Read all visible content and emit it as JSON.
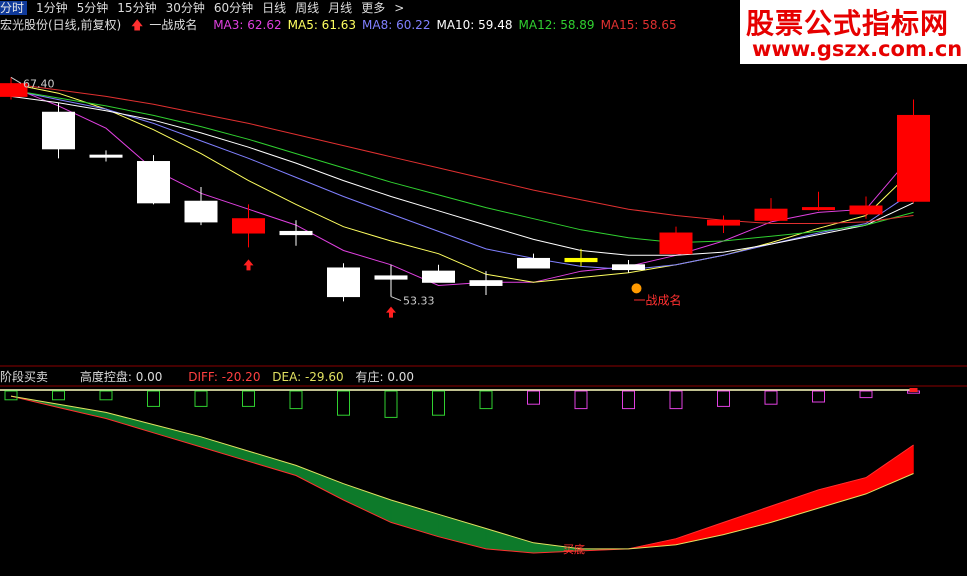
{
  "toolbar": {
    "items": [
      "分时",
      "1分钟",
      "5分钟",
      "15分钟",
      "30分钟",
      "60分钟",
      "日线",
      "周线",
      "月线",
      "更多",
      ">"
    ]
  },
  "stock_title": "宏光股份(日线,前复权)",
  "signal_label": "一战成名",
  "ma_legend": [
    {
      "label": "MA3: ",
      "value": "62.62",
      "color": "#e040e0"
    },
    {
      "label": "MA5: ",
      "value": "61.63",
      "color": "#ffff60"
    },
    {
      "label": "MA8: ",
      "value": "60.22",
      "color": "#8080ff"
    },
    {
      "label": "MA10: ",
      "value": "59.48",
      "color": "#ffffff"
    },
    {
      "label": "MA12: ",
      "value": "58.89",
      "color": "#30d030"
    },
    {
      "label": "MA15: ",
      "value": "58.65",
      "color": "#e03030"
    }
  ],
  "macd_legend": {
    "section": "阶段买卖",
    "gaodu_label": "高度控盘: ",
    "gaodu_value": "0.00",
    "diff_label": "DIFF: ",
    "diff_value": "-20.20",
    "dea_label": "DEA: ",
    "dea_value": "-29.60",
    "youzhuang_label": "有庄: ",
    "youzhuang_value": "0.00"
  },
  "watermark": {
    "title": "股票公式指标网",
    "url": "www.gszx.com.cn"
  },
  "colors": {
    "up": "#ff0000",
    "down": "#ffffff",
    "signal_box": "#ffff00",
    "green_band": "#0d7a2a",
    "red_band": "#ff0000"
  },
  "chart_data": [
    {
      "type": "candlestick",
      "annotations": [
        {
          "text": "67.40",
          "kind": "high"
        },
        {
          "text": "53.33",
          "kind": "low"
        },
        {
          "text": "一战成名",
          "kind": "signal"
        }
      ],
      "ylim": [
        52,
        70
      ],
      "candles": [
        {
          "o": 66.2,
          "c": 67.0,
          "h": 67.4,
          "l": 66.0
        },
        {
          "o": 65.2,
          "c": 62.9,
          "h": 65.8,
          "l": 62.3
        },
        {
          "o": 62.5,
          "c": 62.4,
          "h": 62.8,
          "l": 62.1
        },
        {
          "o": 62.1,
          "c": 59.5,
          "h": 62.5,
          "l": 59.4
        },
        {
          "o": 59.6,
          "c": 58.3,
          "h": 60.5,
          "l": 58.1
        },
        {
          "o": 57.6,
          "c": 58.5,
          "h": 59.4,
          "l": 56.7
        },
        {
          "o": 57.7,
          "c": 57.5,
          "h": 58.4,
          "l": 56.8
        },
        {
          "o": 55.4,
          "c": 53.6,
          "h": 55.7,
          "l": 53.3
        },
        {
          "o": 54.9,
          "c": 54.7,
          "h": 55.6,
          "l": 53.6
        },
        {
          "o": 55.2,
          "c": 54.5,
          "h": 55.6,
          "l": 54.5
        },
        {
          "o": 54.6,
          "c": 54.3,
          "h": 55.2,
          "l": 53.7
        },
        {
          "o": 56.0,
          "c": 55.4,
          "h": 56.3,
          "l": 55.4
        },
        {
          "o": 56.0,
          "c": 55.8,
          "h": 56.6,
          "l": 55.5
        },
        {
          "o": 55.6,
          "c": 55.3,
          "h": 55.9,
          "l": 55.1
        },
        {
          "o": 56.3,
          "c": 57.6,
          "h": 58.0,
          "l": 56.3
        },
        {
          "o": 58.1,
          "c": 58.4,
          "h": 58.7,
          "l": 57.6
        },
        {
          "o": 58.4,
          "c": 59.1,
          "h": 59.8,
          "l": 58.3
        },
        {
          "o": 59.2,
          "c": 59.2,
          "h": 60.2,
          "l": 59.0
        },
        {
          "o": 58.8,
          "c": 59.3,
          "h": 59.9,
          "l": 58.5
        },
        {
          "o": 59.6,
          "c": 65.0,
          "h": 66.0,
          "l": 59.5
        }
      ],
      "series": [
        {
          "name": "MA3",
          "color": "#e040e0",
          "values": [
            66.8,
            65.6,
            64.2,
            61.6,
            60.1,
            59.1,
            58.1,
            56.5,
            55.6,
            54.3,
            54.5,
            54.5,
            55.2,
            55.5,
            56.2,
            57.1,
            58.3,
            58.9,
            59.1,
            62.6
          ]
        },
        {
          "name": "MA5",
          "color": "#ffff60",
          "values": [
            67.0,
            66.4,
            65.4,
            64.1,
            62.6,
            60.9,
            59.4,
            58.0,
            57.1,
            56.3,
            55.0,
            54.5,
            54.8,
            55.1,
            55.6,
            56.2,
            57.0,
            57.9,
            58.7,
            61.6
          ]
        },
        {
          "name": "MA8",
          "color": "#8080ff",
          "values": [
            66.6,
            66.0,
            65.4,
            64.5,
            63.4,
            62.3,
            61.1,
            59.9,
            58.8,
            57.7,
            56.6,
            56.0,
            55.5,
            55.3,
            55.6,
            56.2,
            56.9,
            57.6,
            58.2,
            60.2
          ]
        },
        {
          "name": "MA10",
          "color": "#ffffff",
          "values": [
            66.2,
            65.8,
            65.3,
            64.7,
            63.9,
            63.0,
            62.0,
            60.9,
            59.9,
            59.0,
            58.1,
            57.2,
            56.5,
            56.2,
            56.2,
            56.4,
            56.9,
            57.5,
            58.1,
            59.5
          ]
        },
        {
          "name": "MA12",
          "color": "#30d030",
          "values": [
            66.6,
            66.1,
            65.6,
            65.0,
            64.3,
            63.5,
            62.6,
            61.7,
            60.8,
            60.0,
            59.2,
            58.5,
            57.8,
            57.3,
            57.0,
            57.1,
            57.4,
            57.7,
            58.1,
            58.9
          ]
        },
        {
          "name": "MA15",
          "color": "#e03030",
          "values": [
            67.0,
            66.6,
            66.2,
            65.7,
            65.1,
            64.5,
            63.8,
            63.1,
            62.4,
            61.7,
            61.0,
            60.3,
            59.7,
            59.1,
            58.7,
            58.4,
            58.2,
            58.2,
            58.3,
            58.7
          ]
        }
      ]
    },
    {
      "type": "area",
      "series": [
        {
          "name": "DIFF",
          "values": [
            -1.0,
            -3.8,
            -6.5,
            -10.0,
            -13.5,
            -17.0,
            -20.5,
            -26.5,
            -32.0,
            -35.5,
            -38.5,
            -39.5,
            -39.0,
            -38.5,
            -36.0,
            -32.0,
            -28.0,
            -24.0,
            -21.0,
            -13.0
          ]
        },
        {
          "name": "DEA",
          "values": [
            -1.0,
            -3.0,
            -5.0,
            -8.0,
            -11.0,
            -14.5,
            -18.0,
            -22.5,
            -26.5,
            -30.0,
            -33.5,
            -37.0,
            -38.5,
            -38.5,
            -37.5,
            -35.0,
            -32.0,
            -28.5,
            -25.0,
            -20.0
          ]
        }
      ],
      "bars": [
        -4,
        -4,
        -4,
        -7,
        -7,
        -7,
        -8,
        -11,
        -12,
        -11,
        -8,
        -6,
        -8,
        -8,
        -8,
        -7,
        -6,
        -5,
        -3,
        -1
      ],
      "bar_colors": [
        "#30d030",
        "#30d030",
        "#30d030",
        "#30d030",
        "#30d030",
        "#30d030",
        "#30d030",
        "#30d030",
        "#30d030",
        "#30d030",
        "#30d030",
        "#e040e0",
        "#e040e0",
        "#e040e0",
        "#e040e0",
        "#e040e0",
        "#e040e0",
        "#e040e0",
        "#e040e0",
        "#e040e0"
      ],
      "annotation": "买底"
    }
  ]
}
